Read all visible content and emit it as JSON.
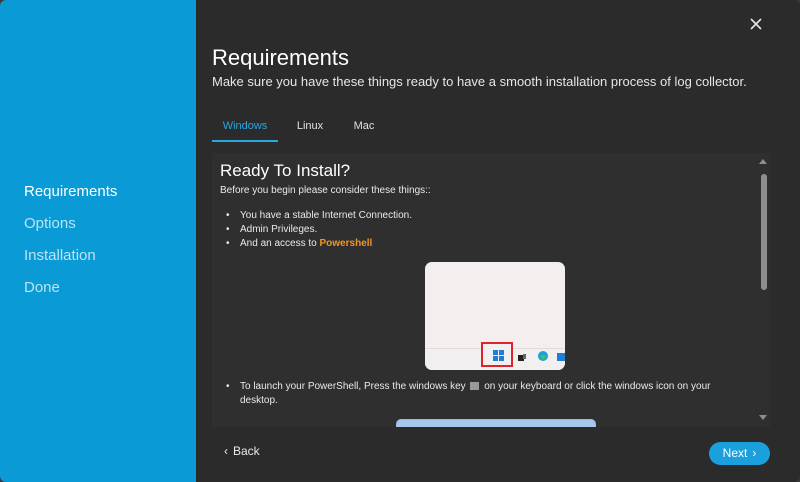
{
  "sidebar": {
    "steps": [
      {
        "label": "Requirements",
        "active": true
      },
      {
        "label": "Options",
        "active": false
      },
      {
        "label": "Installation",
        "active": false
      },
      {
        "label": "Done",
        "active": false
      }
    ]
  },
  "header": {
    "title": "Requirements",
    "subtitle": "Make sure you have these things ready to have a smooth installation process of log collector."
  },
  "tabs": [
    {
      "label": "Windows",
      "active": true
    },
    {
      "label": "Linux",
      "active": false
    },
    {
      "label": "Mac",
      "active": false
    }
  ],
  "content": {
    "heading": "Ready To Install?",
    "intro": "Before you begin please consider these things::",
    "bullets": [
      {
        "text": "You have a stable Internet Connection."
      },
      {
        "text": "Admin Privileges."
      },
      {
        "text": "And an access to ",
        "highlight": "Powershell"
      }
    ],
    "launch_text_before": "To launch your PowerShell, Press the windows key",
    "launch_text_after": "on your keyboard or click the windows icon on your desktop."
  },
  "footer": {
    "back_label": "Back",
    "next_label": "Next"
  },
  "colors": {
    "sidebar": "#0a9bd6",
    "accent": "#2aa6e0",
    "highlight": "#f0962a",
    "background": "#2b2b2b"
  }
}
